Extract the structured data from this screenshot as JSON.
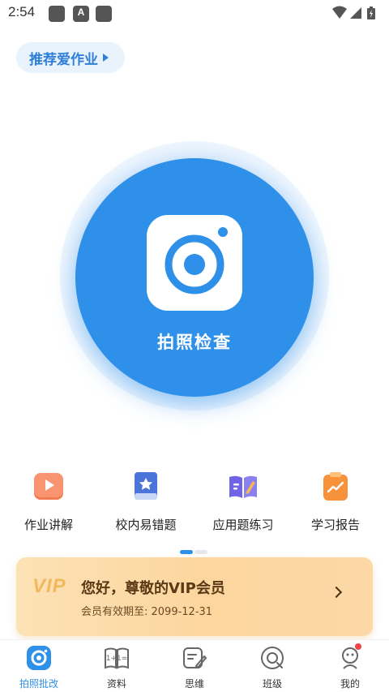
{
  "status_bar": {
    "time": "2:54",
    "notification_icons": [
      "app-icon",
      "a-icon",
      "app-icon"
    ],
    "system_icons": [
      "wifi-icon",
      "signal-icon",
      "battery-icon"
    ]
  },
  "recommend": {
    "label": "推荐爱作业",
    "icon": "triangle-right-icon"
  },
  "camera_button": {
    "label": "拍照检查",
    "icon": "camera-icon",
    "color": "#2f90ea"
  },
  "features": [
    {
      "label": "作业讲解",
      "icon": "video-play-icon"
    },
    {
      "label": "校内易错题",
      "icon": "star-book-icon"
    },
    {
      "label": "应用题练习",
      "icon": "open-book-pencil-icon"
    },
    {
      "label": "学习报告",
      "icon": "clipboard-chart-icon"
    }
  ],
  "pager": {
    "pages": 2,
    "current": 1
  },
  "vip": {
    "logo": "VIP",
    "title": "您好，尊敬的VIP会员",
    "subtitle": "会员有效期至: 2099-12-31"
  },
  "bottom_nav": {
    "tabs": [
      {
        "label": "拍照批改",
        "icon": "camera-check-icon",
        "active": true
      },
      {
        "label": "资料",
        "icon": "book-math-icon",
        "active": false
      },
      {
        "label": "思维",
        "icon": "note-pencil-icon",
        "active": false
      },
      {
        "label": "班级",
        "icon": "target-icon",
        "active": false
      },
      {
        "label": "我的",
        "icon": "user-icon",
        "active": false,
        "badge": true
      }
    ]
  },
  "colors": {
    "accent": "#2f90ea",
    "vip_gold": "#f1b85e",
    "badge_red": "#f04646"
  }
}
